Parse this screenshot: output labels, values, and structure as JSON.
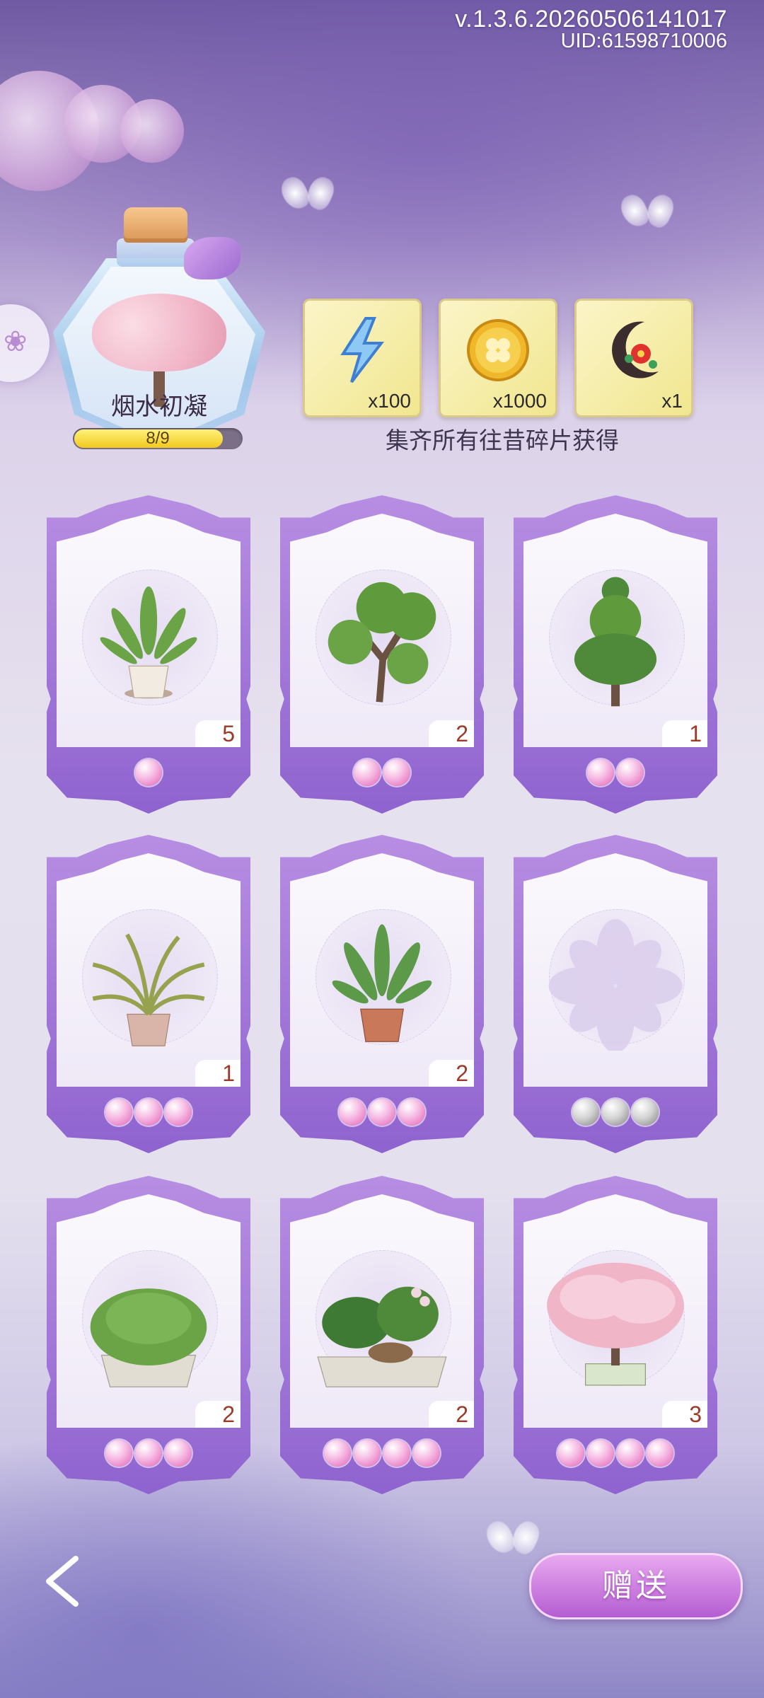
{
  "header": {
    "version": "v.1.3.6.20260506141017",
    "uid": "UID:61598710006"
  },
  "collection": {
    "name": "烟水初凝",
    "progress_text": "8/9",
    "progress_fraction": 0.889
  },
  "rewards": [
    {
      "icon": "lightning-energy-icon",
      "qty": "x100"
    },
    {
      "icon": "gold-clover-coin-icon",
      "qty": "x1000"
    },
    {
      "icon": "crescent-flower-hairpin-icon",
      "qty": "x1"
    }
  ],
  "caption": "集齐所有往昔碎片获得",
  "cards": [
    {
      "plant": "potted-plant",
      "count": "5",
      "pearls": 1,
      "pearl_color": "pink"
    },
    {
      "plant": "bonsai-tree",
      "count": "2",
      "pearls": 2,
      "pearl_color": "pink"
    },
    {
      "plant": "topiary-tree",
      "count": "1",
      "pearls": 2,
      "pearl_color": "pink"
    },
    {
      "plant": "palm-potted",
      "count": "1",
      "pearls": 3,
      "pearl_color": "pink"
    },
    {
      "plant": "bird-of-paradise",
      "count": "2",
      "pearls": 3,
      "pearl_color": "pink"
    },
    {
      "plant": "empty-placeholder",
      "count": "",
      "pearls": 3,
      "pearl_color": "grey"
    },
    {
      "plant": "hedge-planter",
      "count": "2",
      "pearls": 3,
      "pearl_color": "pink"
    },
    {
      "plant": "monstera-garden",
      "count": "2",
      "pearls": 4,
      "pearl_color": "pink"
    },
    {
      "plant": "cherry-blossom-tree",
      "count": "3",
      "pearls": 4,
      "pearl_color": "pink"
    }
  ],
  "buttons": {
    "back_icon": "back-arrow-icon",
    "gift_label": "赠送"
  }
}
